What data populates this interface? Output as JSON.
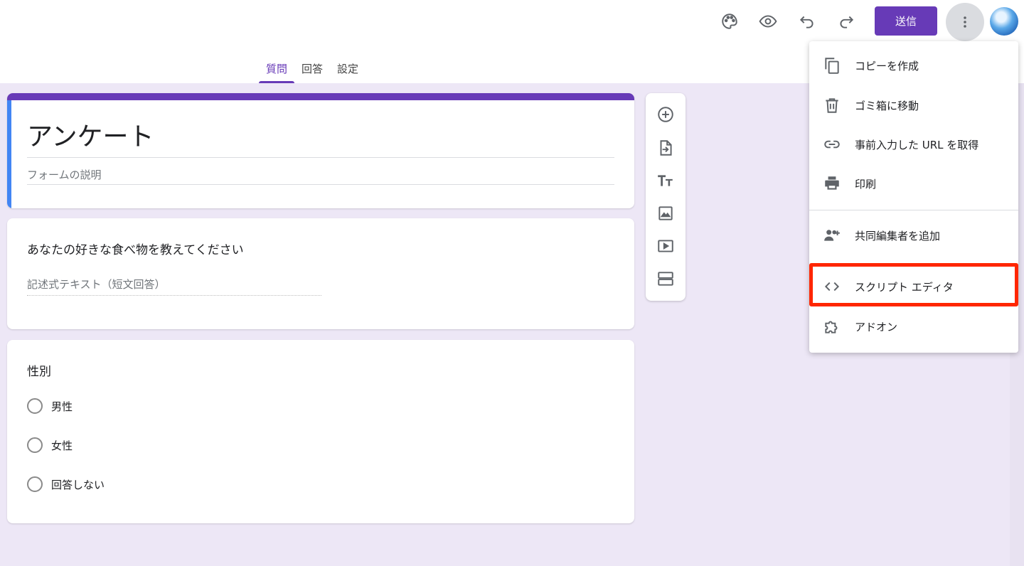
{
  "header": {
    "icons": [
      "palette-icon",
      "eye-icon",
      "undo-icon",
      "redo-icon"
    ],
    "send_label": "送信",
    "more_icon": "more-vert-icon"
  },
  "tabs": [
    {
      "label": "質問",
      "active": true
    },
    {
      "label": "回答",
      "active": false
    },
    {
      "label": "設定",
      "active": false
    }
  ],
  "form": {
    "title": "アンケート",
    "description_placeholder": "フォームの説明"
  },
  "questions": [
    {
      "title": "あなたの好きな食べ物を教えてください",
      "type": "short-answer",
      "hint": "記述式テキスト（短文回答）"
    },
    {
      "title": "性別",
      "type": "multiple-choice",
      "options": [
        "男性",
        "女性",
        "回答しない"
      ]
    }
  ],
  "side_toolbar": {
    "icons": [
      "add-question-icon",
      "import-questions-icon",
      "add-title-icon",
      "add-image-icon",
      "add-video-icon",
      "add-section-icon"
    ]
  },
  "menu": {
    "items": [
      {
        "label": "コピーを作成",
        "icon": "copy-icon"
      },
      {
        "label": "ゴミ箱に移動",
        "icon": "trash-icon"
      },
      {
        "label": "事前入力した URL を取得",
        "icon": "link-icon"
      },
      {
        "label": "印刷",
        "icon": "print-icon"
      },
      {
        "label": "共同編集者を追加",
        "icon": "add-people-icon"
      },
      {
        "label": "スクリプト エディタ",
        "icon": "code-icon",
        "highlighted": true
      },
      {
        "label": "アドオン",
        "icon": "puzzle-icon"
      }
    ]
  },
  "colors": {
    "accent": "#673ab7",
    "background": "#ede7f6",
    "title_left_bar": "#4285f4",
    "highlight": "#ff2600"
  }
}
